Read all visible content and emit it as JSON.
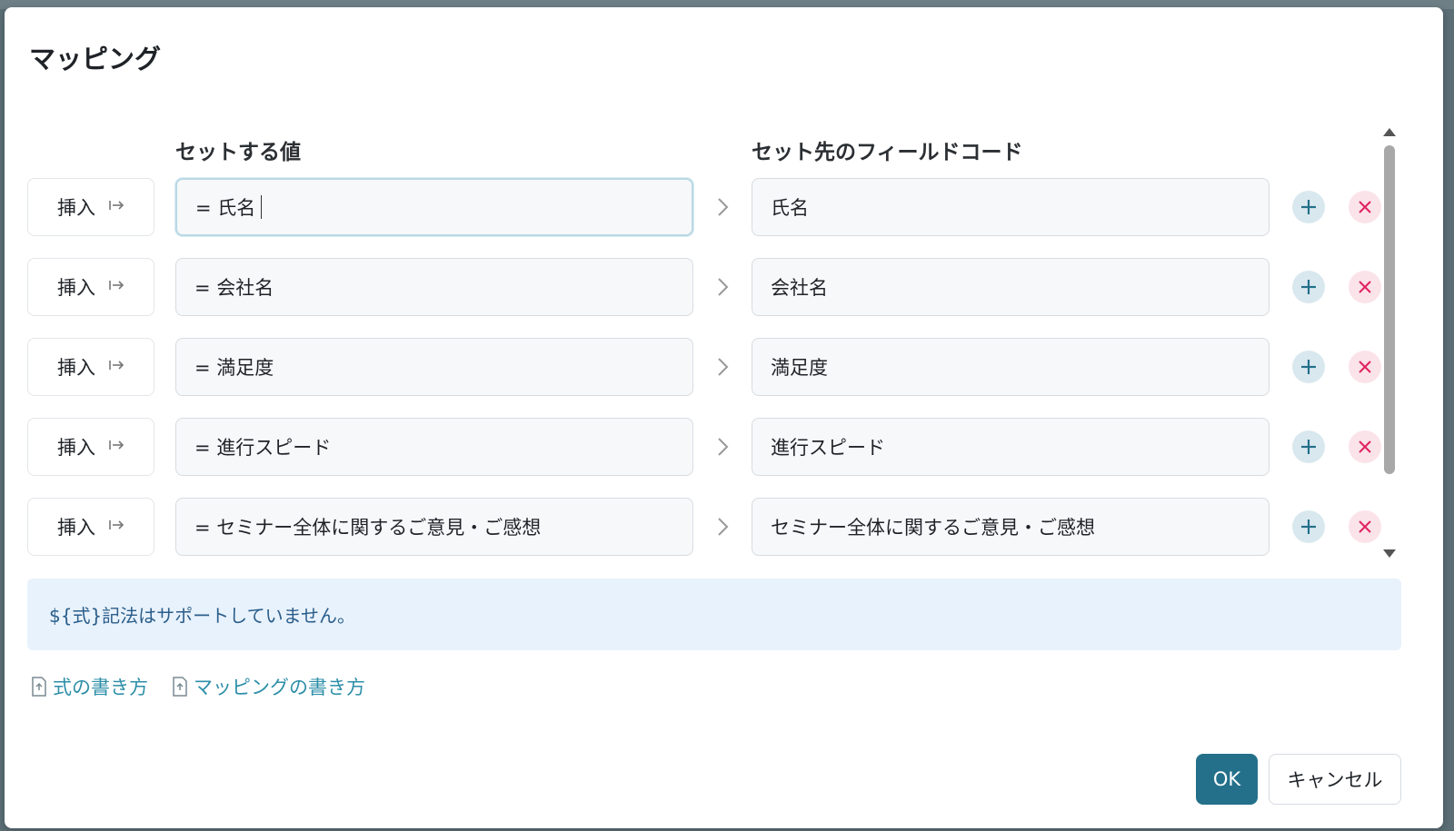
{
  "dialog": {
    "title": "マッピング",
    "headers": {
      "value": "セットする値",
      "target": "セット先のフィールドコード"
    },
    "insert_label": "挿入",
    "rows": [
      {
        "value": "= 氏名",
        "target": "氏名"
      },
      {
        "value": "= 会社名",
        "target": "会社名"
      },
      {
        "value": "= 満足度",
        "target": "満足度"
      },
      {
        "value": "= 進行スピード",
        "target": "進行スピード"
      },
      {
        "value": "= セミナー全体に関するご意見・ご感想",
        "target": "セミナー全体に関するご意見・ご感想"
      }
    ],
    "notice": "${式}記法はサポートしていません。",
    "links": [
      {
        "label": "式の書き方",
        "icon": "document-icon"
      },
      {
        "label": "マッピングの書き方",
        "icon": "document-icon"
      }
    ],
    "ok_label": "OK",
    "cancel_label": "キャンセル"
  },
  "colors": {
    "primary": "#24708a",
    "link": "#2d8fa8",
    "notice_bg": "#e8f2fc",
    "notice_text": "#2a5d8a",
    "add_bg": "#d9e8ef",
    "delete_bg": "#fbe3ea",
    "delete_icon": "#e0245e"
  }
}
